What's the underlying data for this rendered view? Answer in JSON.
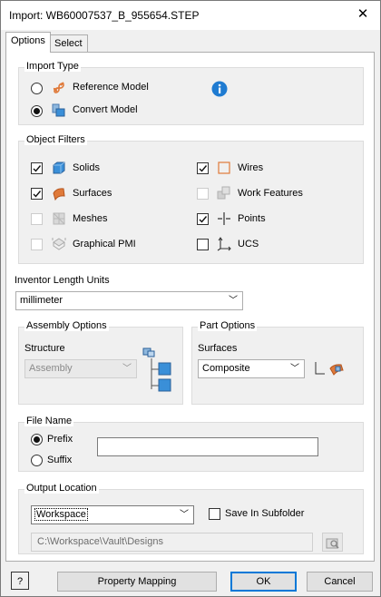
{
  "window": {
    "title": "Import:  WB60007537_B_955654.STEP",
    "close_glyph": "✕"
  },
  "tabs": [
    {
      "label": "Options",
      "active": true
    },
    {
      "label": "Select",
      "active": false
    }
  ],
  "import_type": {
    "title": "Import Type",
    "reference_label": "Reference Model",
    "convert_label": "Convert Model",
    "selected": "convert",
    "info_icon": "info-icon"
  },
  "object_filters": {
    "title": "Object Filters",
    "items": [
      {
        "label": "Solids",
        "checked": true,
        "enabled": true,
        "icon": "solids-icon"
      },
      {
        "label": "Wires",
        "checked": true,
        "enabled": true,
        "icon": "wires-icon"
      },
      {
        "label": "Surfaces",
        "checked": true,
        "enabled": true,
        "icon": "surfaces-icon"
      },
      {
        "label": "Work Features",
        "checked": false,
        "enabled": false,
        "icon": "work-features-icon"
      },
      {
        "label": "Meshes",
        "checked": false,
        "enabled": false,
        "icon": "meshes-icon"
      },
      {
        "label": "Points",
        "checked": true,
        "enabled": true,
        "icon": "points-icon"
      },
      {
        "label": "Graphical PMI",
        "checked": false,
        "enabled": false,
        "icon": "pmi-icon"
      },
      {
        "label": "UCS",
        "checked": false,
        "enabled": true,
        "icon": "ucs-icon"
      }
    ]
  },
  "length_units": {
    "label": "Inventor Length Units",
    "value": "millimeter"
  },
  "assembly_options": {
    "title": "Assembly Options",
    "structure_label": "Structure",
    "structure_value": "Assembly"
  },
  "part_options": {
    "title": "Part Options",
    "surfaces_label": "Surfaces",
    "surfaces_value": "Composite"
  },
  "file_name": {
    "title": "File Name",
    "prefix_label": "Prefix",
    "suffix_label": "Suffix",
    "selected": "prefix",
    "value": ""
  },
  "output_location": {
    "title": "Output Location",
    "location_value": "Workspace",
    "subfolder_label": "Save In Subfolder",
    "subfolder_checked": false,
    "path": "C:\\Workspace\\Vault\\Designs"
  },
  "footer": {
    "help_glyph": "?",
    "property_mapping_label": "Property Mapping",
    "ok_label": "OK",
    "cancel_label": "Cancel"
  },
  "colors": {
    "accent": "#0078d7",
    "solid_blue": "#3a8fd8",
    "surface_orange": "#e07a3a"
  }
}
